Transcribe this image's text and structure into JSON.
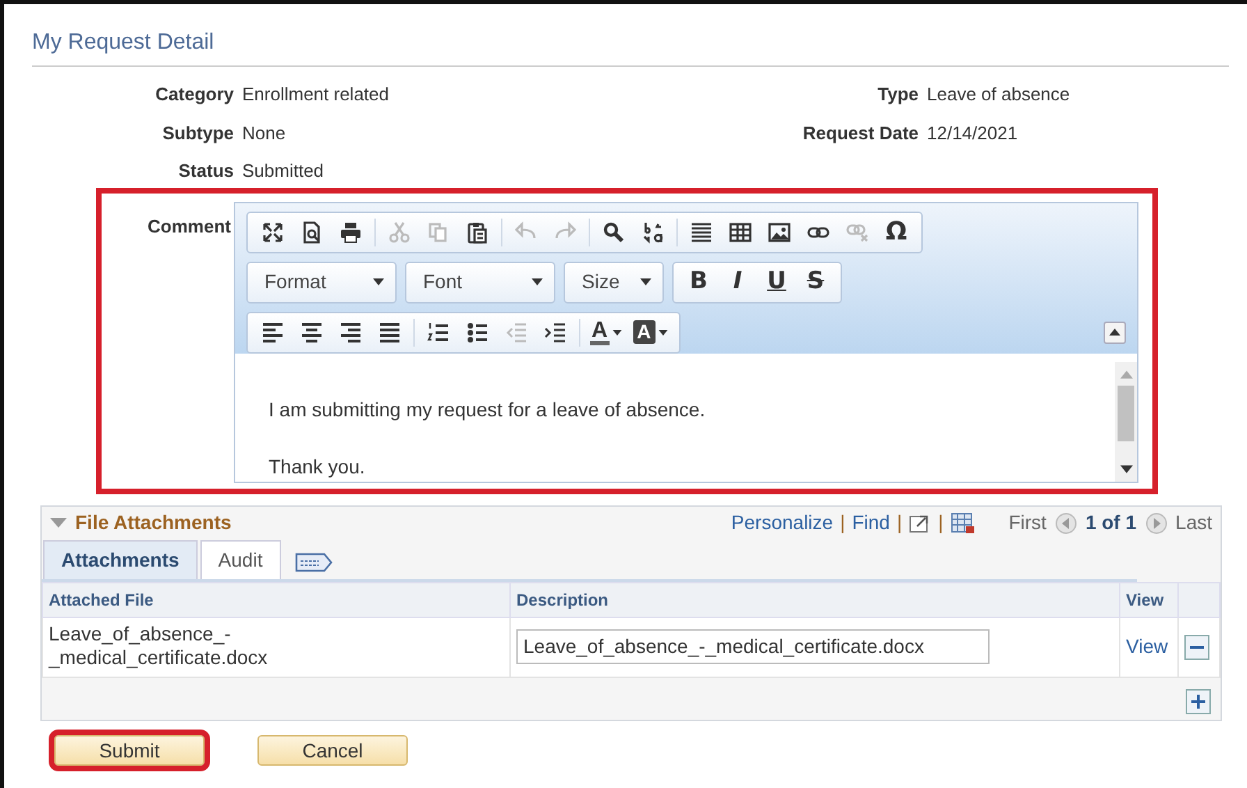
{
  "page": {
    "title": "My Request Detail"
  },
  "fields": [
    [
      {
        "label": "Category",
        "value": "Enrollment related"
      },
      {
        "label": "Type",
        "value": "Leave of absence"
      }
    ],
    [
      {
        "label": "Subtype",
        "value": "None"
      },
      {
        "label": "Request Date",
        "value": "12/14/2021"
      }
    ],
    [
      {
        "label": "Status",
        "value": "Submitted"
      }
    ]
  ],
  "comment": {
    "label": "Comment",
    "highlighted": true,
    "toolbar": [
      [
        [
          {
            "kind": "icon",
            "disabled": false
          },
          {
            "kind": "icon",
            "disabled": false
          },
          {
            "kind": "icon",
            "disabled": false
          }
        ],
        [
          {
            "kind": "icon",
            "disabled": true
          },
          {
            "kind": "icon",
            "disabled": true
          },
          {
            "kind": "icon",
            "disabled": false
          }
        ],
        [
          {
            "kind": "icon",
            "disabled": true
          },
          {
            "kind": "icon",
            "disabled": true
          }
        ],
        [
          {
            "kind": "icon",
            "disabled": false
          },
          {
            "kind": "icon",
            "disabled": false
          }
        ],
        [
          {
            "kind": "icon",
            "disabled": false
          },
          {
            "kind": "icon",
            "disabled": false
          },
          {
            "kind": "icon",
            "disabled": false
          },
          {
            "kind": "icon",
            "disabled": false
          },
          {
            "kind": "icon",
            "disabled": true
          },
          {
            "kind": "char",
            "label": "Ω",
            "disabled": false
          }
        ]
      ],
      [
        [
          {
            "kind": "dropdown",
            "label": "Format"
          }
        ],
        [
          {
            "kind": "dropdown",
            "label": "Font"
          }
        ],
        [
          {
            "kind": "dropdown",
            "label": "Size"
          }
        ],
        [
          {
            "kind": "bold",
            "label": "B"
          },
          {
            "kind": "italic",
            "label": "I"
          },
          {
            "kind": "underline",
            "label": "U"
          },
          {
            "kind": "strike",
            "label": "S"
          }
        ]
      ],
      [
        [
          {
            "kind": "icon",
            "disabled": false
          },
          {
            "kind": "icon",
            "disabled": false
          },
          {
            "kind": "icon",
            "disabled": false
          },
          {
            "kind": "icon",
            "disabled": false
          }
        ],
        [
          {
            "kind": "icon",
            "disabled": false
          },
          {
            "kind": "icon",
            "disabled": false
          },
          {
            "kind": "icon",
            "disabled": true
          },
          {
            "kind": "icon",
            "disabled": false
          }
        ],
        [
          {
            "kind": "text-color",
            "label": "A"
          },
          {
            "kind": "bg-color",
            "label": "A"
          }
        ]
      ]
    ],
    "paragraphs": [
      "I am submitting my request for a leave of absence.",
      "Thank you."
    ]
  },
  "attachments": {
    "title": "File Attachments",
    "expanded": true,
    "links": [
      "Personalize",
      "Find"
    ],
    "separators": [
      "|",
      "|",
      "|"
    ],
    "first": "First",
    "range": "1 of 1",
    "last": "Last",
    "tabs": [
      {
        "label": "Attachments",
        "selected": true
      },
      {
        "label": "Audit",
        "selected": false
      }
    ],
    "columns": [
      "Attached File",
      "Description",
      "View"
    ],
    "rows": [
      {
        "file": "Leave_of_absence_-_medical_certificate.docx",
        "description": "Leave_of_absence_-_medical_certificate.docx",
        "view": "View"
      }
    ]
  },
  "buttons": [
    {
      "label": "Submit",
      "highlighted": true
    },
    {
      "label": "Cancel",
      "highlighted": false
    }
  ]
}
